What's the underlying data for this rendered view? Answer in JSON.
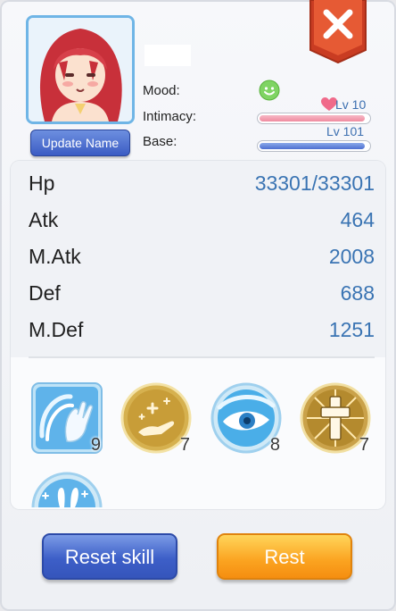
{
  "header": {
    "update_name_label": "Update Name",
    "name_value": ""
  },
  "info": {
    "mood_label": "Mood:",
    "mood_icon": "smiley-face-icon",
    "intimacy_label": "Intimacy:",
    "intimacy_level": "Lv 10",
    "intimacy_fill_fraction": 0.97,
    "base_label": "Base:",
    "base_level": "Lv 101",
    "base_fill_fraction": 0.97
  },
  "stats": [
    {
      "label": "Hp",
      "value": "33301/33301"
    },
    {
      "label": "Atk",
      "value": "464"
    },
    {
      "label": "M.Atk",
      "value": "2008"
    },
    {
      "label": "Def",
      "value": "688"
    },
    {
      "label": "M.Def",
      "value": "1251"
    }
  ],
  "skills": [
    {
      "icon": "wind-hand-skill-icon",
      "level": "9"
    },
    {
      "icon": "heal-hand-skill-icon",
      "level": "7"
    },
    {
      "icon": "eye-skill-icon",
      "level": "8"
    },
    {
      "icon": "holy-cross-skill-icon",
      "level": "7"
    },
    {
      "icon": "bunny-sparkle-skill-icon",
      "level": ""
    }
  ],
  "buttons": {
    "reset_skill": "Reset skill",
    "rest": "Rest"
  },
  "colors": {
    "accent_blue": "#3a74b3",
    "close_red": "#e24a2a",
    "rest_orange": "#fba320",
    "reset_blue": "#3d5fc8"
  }
}
